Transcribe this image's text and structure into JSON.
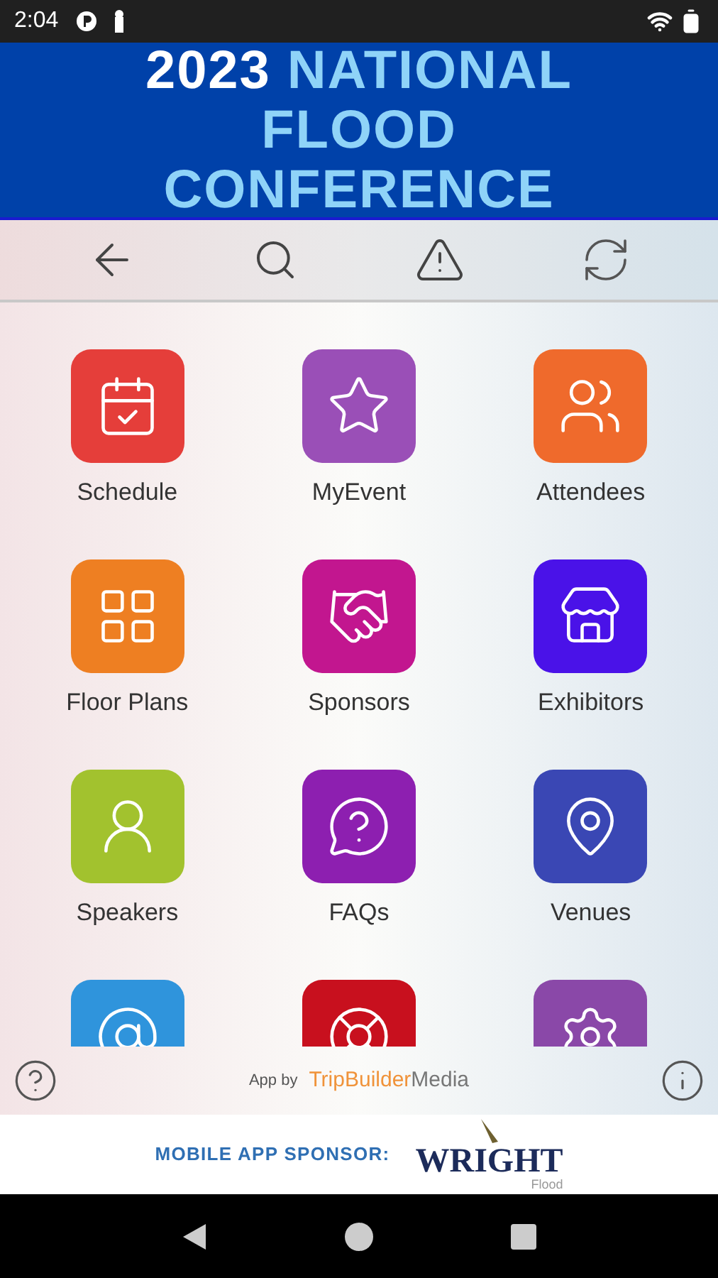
{
  "status_bar": {
    "time": "2:04"
  },
  "header": {
    "year": "2023",
    "name": "NATIONAL FLOOD CONFERENCE"
  },
  "tiles": [
    {
      "label": "Schedule",
      "color": "#e53e3a"
    },
    {
      "label": "MyEvent",
      "color": "#9a4fb7"
    },
    {
      "label": "Attendees",
      "color": "#ef6a2c"
    },
    {
      "label": "Floor Plans",
      "color": "#ee7f22"
    },
    {
      "label": "Sponsors",
      "color": "#c2168f"
    },
    {
      "label": "Exhibitors",
      "color": "#4a12e8"
    },
    {
      "label": "Speakers",
      "color": "#a2c22e"
    },
    {
      "label": "FAQs",
      "color": "#8d1fb0"
    },
    {
      "label": "Venues",
      "color": "#3a47b4"
    },
    {
      "color": "#2f94dc"
    },
    {
      "color": "#c8101e"
    },
    {
      "color": "#8a48a8"
    }
  ],
  "footer": {
    "credit": "App by",
    "brand_accent": "TripBuilder",
    "brand_rest": "Media"
  },
  "sponsor_banner": {
    "label": "MOBILE APP SPONSOR:",
    "logo": "WRIGHT",
    "logo_sub": "Flood"
  }
}
